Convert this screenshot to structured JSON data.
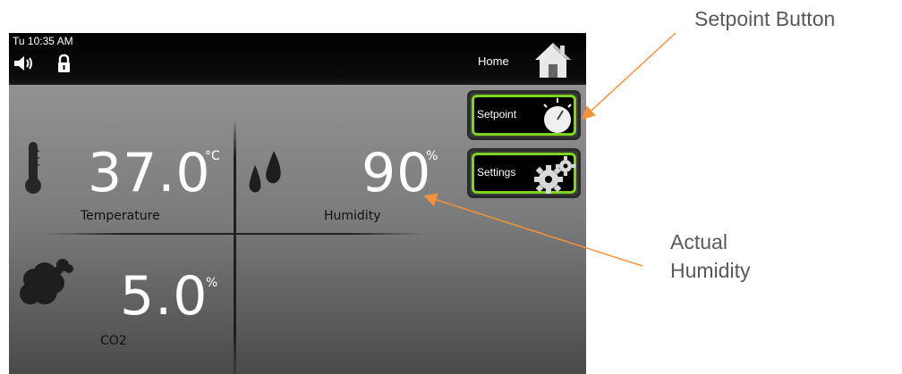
{
  "status_bar": {
    "clock": "Tu 10:35 AM",
    "home_label": "Home",
    "icons": [
      "speaker-icon",
      "lock-icon",
      "home-icon"
    ]
  },
  "readings": {
    "temperature": {
      "value": "37.0",
      "unit": "°C",
      "label": "Temperature",
      "icon": "thermometer-icon"
    },
    "humidity": {
      "value": "90",
      "unit": "%",
      "label": "Humidity",
      "icon": "water-drops-icon"
    },
    "co2": {
      "value": "5.0",
      "unit": "%",
      "label": "CO2",
      "icon": "cloud-icon"
    }
  },
  "side_buttons": {
    "setpoint": {
      "label": "Setpoint",
      "icon": "dial-icon"
    },
    "settings": {
      "label": "Settings",
      "icon": "gears-icon"
    }
  },
  "annotations": {
    "setpoint_button": "Setpoint Button",
    "actual_humidity_line1": "Actual",
    "actual_humidity_line2": "Humidity",
    "arrow_color": "#f4923a"
  },
  "colors": {
    "button_border": "#7ed321",
    "status_bar": "#000000"
  }
}
